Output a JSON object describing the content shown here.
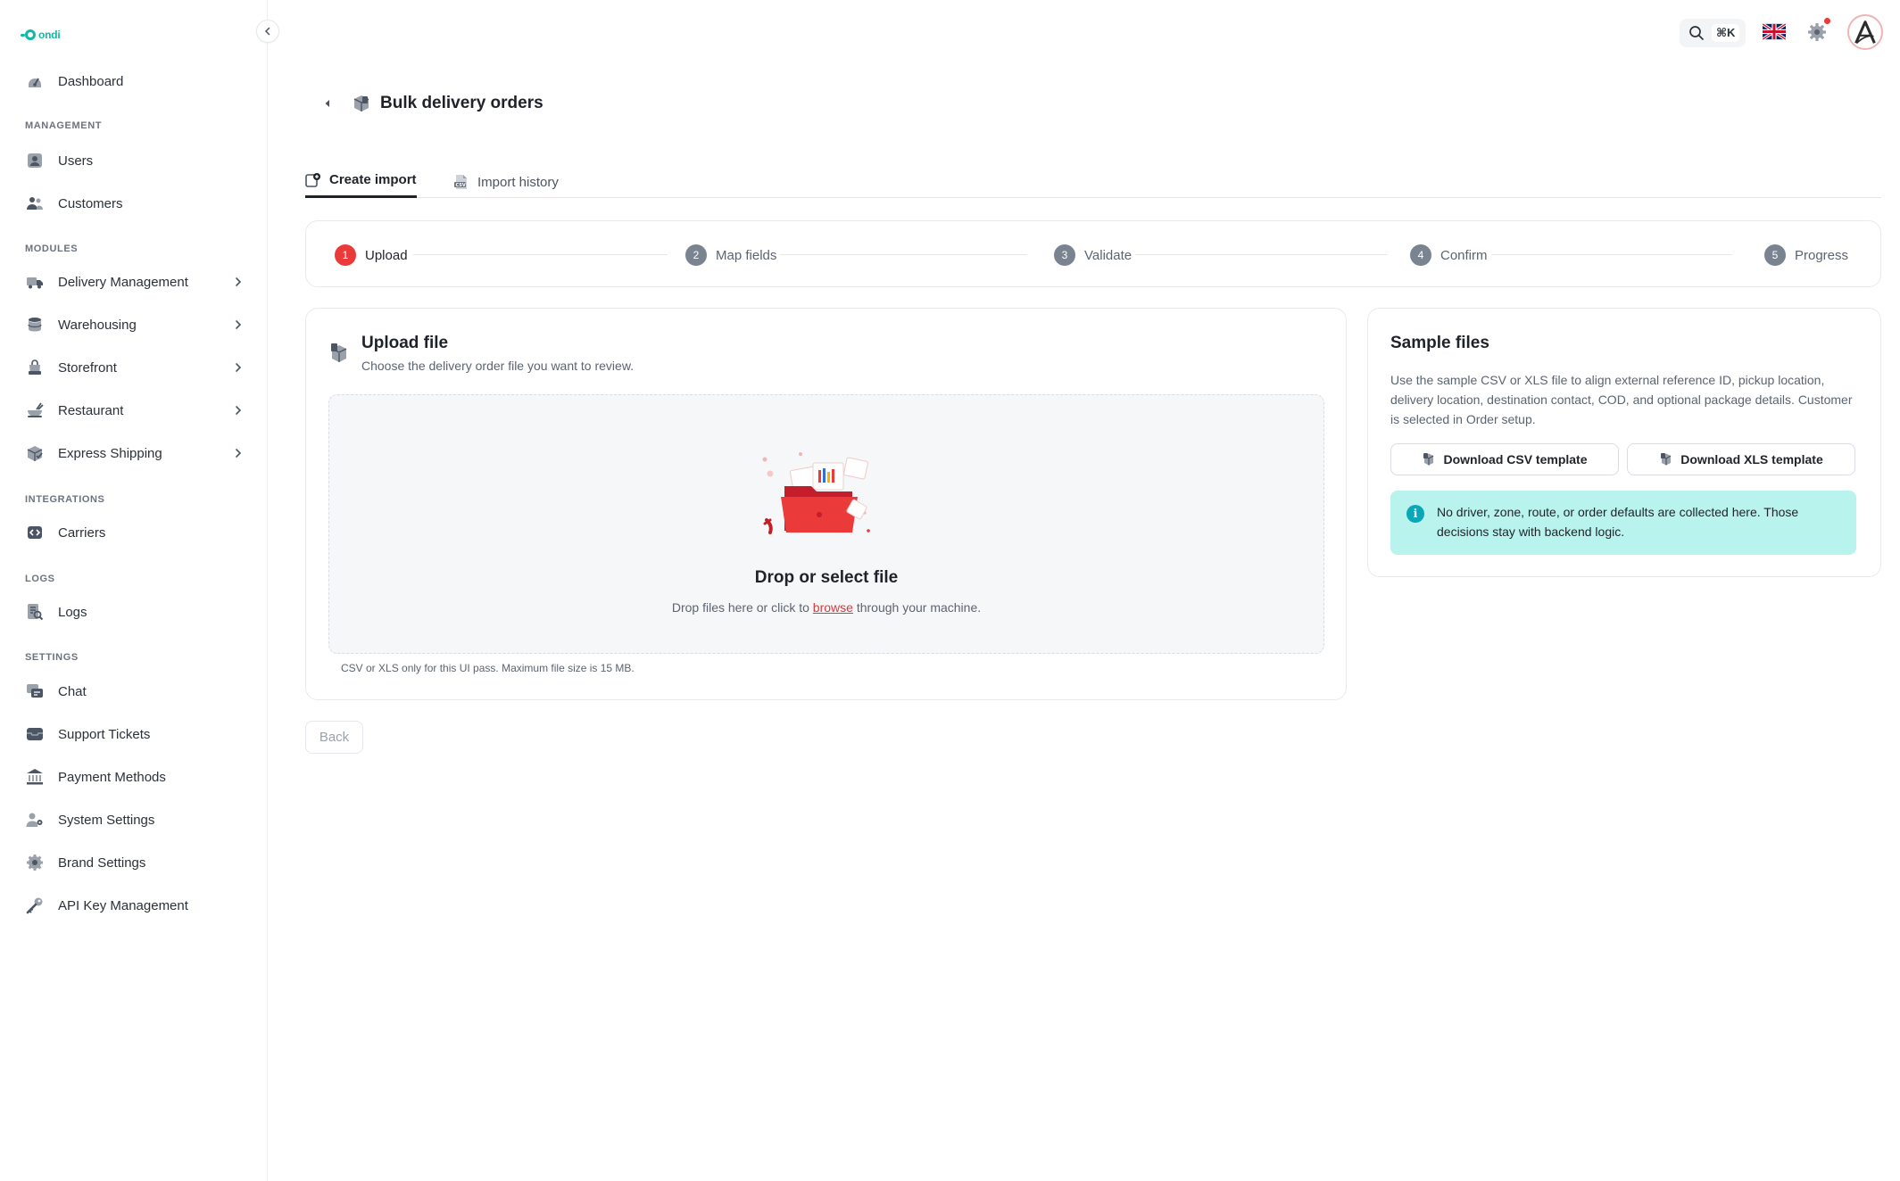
{
  "brand": {
    "logo_text": "ondi"
  },
  "sidebar": {
    "dashboard": {
      "label": "Dashboard"
    },
    "sections": {
      "management": "MANAGEMENT",
      "modules": "MODULES",
      "integrations": "INTEGRATIONS",
      "logs": "LOGS",
      "settings": "SETTINGS"
    },
    "items": {
      "users": "Users",
      "customers": "Customers",
      "delivery_management": "Delivery Management",
      "warehousing": "Warehousing",
      "storefront": "Storefront",
      "restaurant": "Restaurant",
      "express_shipping": "Express Shipping",
      "carriers": "Carriers",
      "logs": "Logs",
      "chat": "Chat",
      "support_tickets": "Support Tickets",
      "payment_methods": "Payment Methods",
      "system_settings": "System Settings",
      "brand_settings": "Brand Settings",
      "api_key_management": "API Key Management"
    }
  },
  "topbar": {
    "search_shortcut": "⌘K",
    "language_icon": "uk-flag-icon",
    "settings_icon": "gear-icon"
  },
  "page": {
    "title": "Bulk delivery orders",
    "tabs": [
      {
        "label": "Create import"
      },
      {
        "label": "Import history"
      }
    ]
  },
  "stepper": {
    "steps": [
      {
        "num": "1",
        "label": "Upload"
      },
      {
        "num": "2",
        "label": "Map fields"
      },
      {
        "num": "3",
        "label": "Validate"
      },
      {
        "num": "4",
        "label": "Confirm"
      },
      {
        "num": "5",
        "label": "Progress"
      }
    ],
    "current_step": 1
  },
  "upload": {
    "title": "Upload file",
    "subtitle": "Choose the delivery order file you want to review.",
    "drop_title": "Drop or select file",
    "drop_prefix": "Drop files here or click to",
    "browse_link": "browse",
    "drop_suffix": "through your machine.",
    "note": "CSV or XLS only for this UI pass. Maximum file size is 15 MB."
  },
  "actions": {
    "back_label": "Back"
  },
  "samples": {
    "title": "Sample files",
    "description": "Use the sample CSV or XLS file to align external reference ID, pickup location, delivery location, destination contact, COD, and optional package details. Customer is selected in Order setup.",
    "csv_button": "Download CSV template",
    "xls_button": "Download XLS template",
    "info": "No driver, zone, route, or order defaults are collected here. Those decisions stay with backend logic."
  },
  "colors": {
    "accent": "#ea3a3a",
    "brand": "#12b8a6",
    "info_bg": "#b8f4ed",
    "info_icon": "#0aa7b8"
  }
}
